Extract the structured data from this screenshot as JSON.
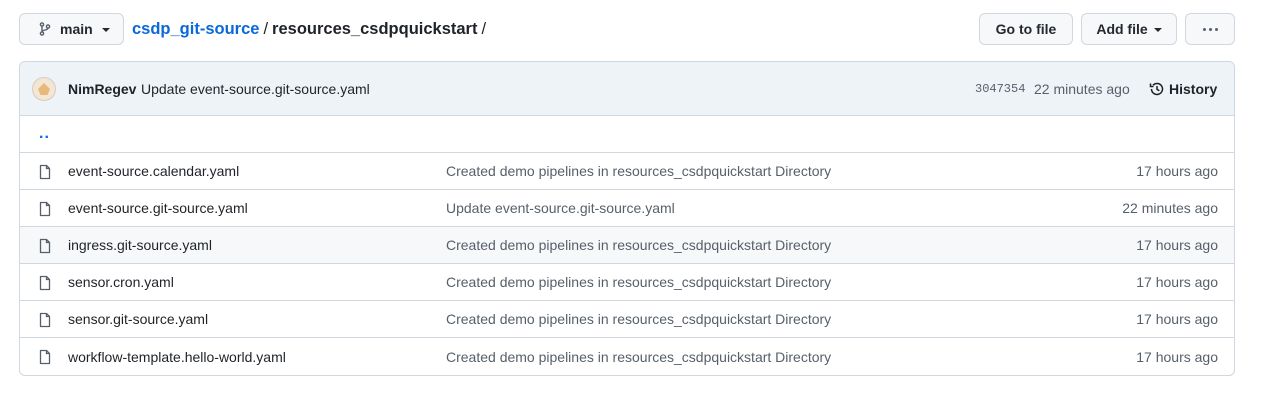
{
  "branch": {
    "name": "main"
  },
  "breadcrumb": {
    "repo": "csdp_git-source",
    "sep1": "/",
    "dir": "resources_csdpquickstart",
    "sep2": "/"
  },
  "actions": {
    "go_to_file": "Go to file",
    "add_file": "Add file",
    "more_icon": "kebab-horizontal-icon"
  },
  "latest_commit": {
    "author": "NimRegev",
    "message": "Update event-source.git-source.yaml",
    "sha": "3047354",
    "time": "22 minutes ago",
    "history_label": "History"
  },
  "parent_dir": "..",
  "files": [
    {
      "name": "event-source.calendar.yaml",
      "commit": "Created demo pipelines in resources_csdpquickstart Directory",
      "time": "17 hours ago"
    },
    {
      "name": "event-source.git-source.yaml",
      "commit": "Update event-source.git-source.yaml",
      "time": "22 minutes ago"
    },
    {
      "name": "ingress.git-source.yaml",
      "commit": "Created demo pipelines in resources_csdpquickstart Directory",
      "time": "17 hours ago"
    },
    {
      "name": "sensor.cron.yaml",
      "commit": "Created demo pipelines in resources_csdpquickstart Directory",
      "time": "17 hours ago"
    },
    {
      "name": "sensor.git-source.yaml",
      "commit": "Created demo pipelines in resources_csdpquickstart Directory",
      "time": "17 hours ago"
    },
    {
      "name": "workflow-template.hello-world.yaml",
      "commit": "Created demo pipelines in resources_csdpquickstart Directory",
      "time": "17 hours ago"
    }
  ],
  "colors": {
    "link": "#0969da",
    "muted": "#57606a",
    "border": "#d0d7de",
    "header_bg": "#eef3f8"
  }
}
